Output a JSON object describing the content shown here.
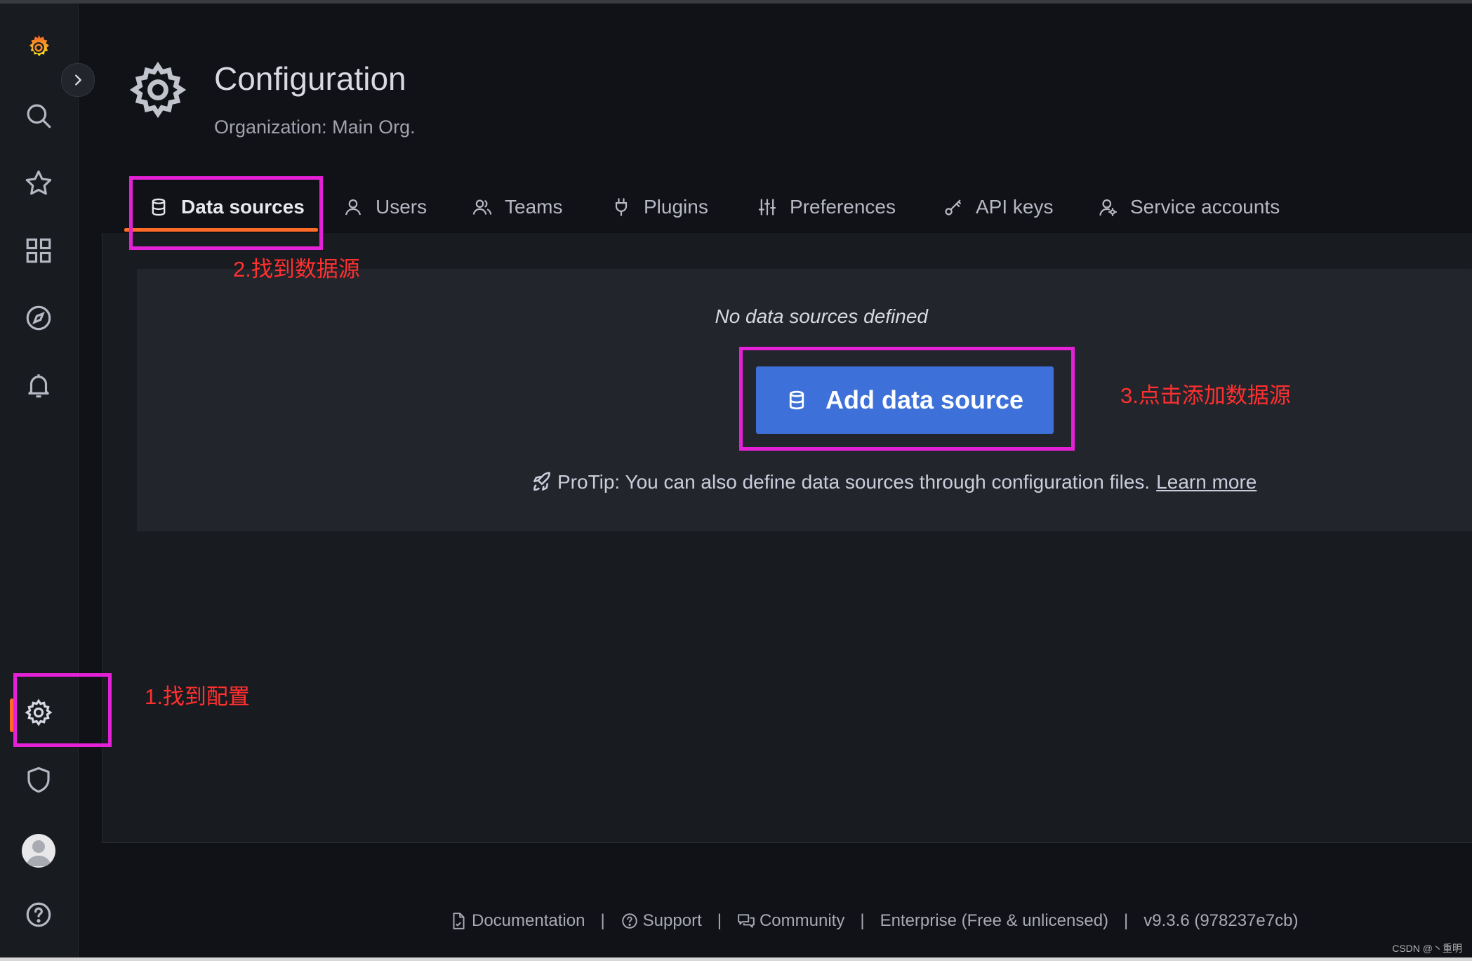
{
  "header": {
    "title": "Configuration",
    "subtitle": "Organization: Main Org."
  },
  "tabs": [
    {
      "label": "Data sources",
      "icon": "database-icon",
      "active": true
    },
    {
      "label": "Users",
      "icon": "user-icon"
    },
    {
      "label": "Teams",
      "icon": "users-icon"
    },
    {
      "label": "Plugins",
      "icon": "plug-icon"
    },
    {
      "label": "Preferences",
      "icon": "sliders-icon"
    },
    {
      "label": "API keys",
      "icon": "key-icon"
    },
    {
      "label": "Service accounts",
      "icon": "service-account-icon"
    }
  ],
  "empty_state": {
    "title": "No data sources defined",
    "button_label": "Add data source",
    "protip_text": "ProTip: You can also define data sources through configuration files.",
    "protip_link": "Learn more"
  },
  "annotations": {
    "step1": "1.找到配置",
    "step2": "2.找到数据源",
    "step3": "3.点击添加数据源"
  },
  "footer": {
    "documentation": "Documentation",
    "support": "Support",
    "community": "Community",
    "enterprise": "Enterprise (Free & unlicensed)",
    "version": "v9.3.6 (978237e7cb)",
    "separator": "|"
  },
  "watermark": "CSDN @丶重明",
  "colors": {
    "accent": "#ff6a26",
    "primary_button": "#3d71d9",
    "annotation_box": "#e521d7",
    "annotation_text": "#ff3030"
  }
}
